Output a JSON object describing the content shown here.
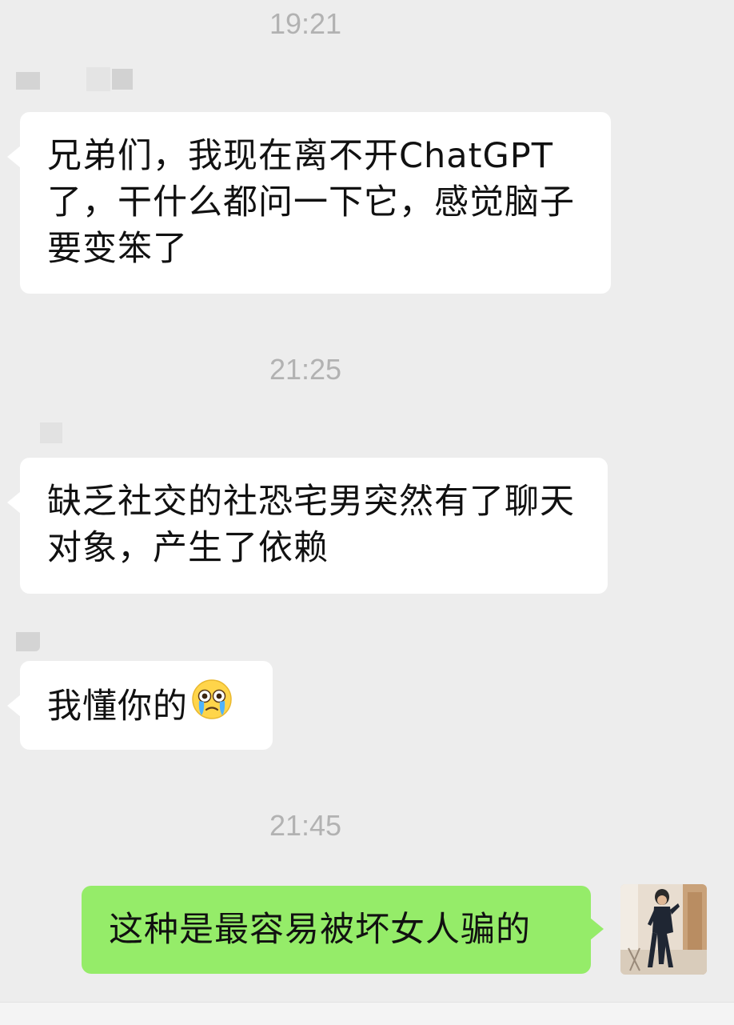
{
  "messages": [
    {
      "type": "time",
      "text": "19:21"
    },
    {
      "type": "incoming",
      "text": "兄弟们，我现在离不开ChatGPT了，干什么都问一下它，感觉脑子要变笨了"
    },
    {
      "type": "time",
      "text": "21:25"
    },
    {
      "type": "incoming",
      "text": "缺乏社交的社恐宅男突然有了聊天对象，产生了依赖"
    },
    {
      "type": "incoming",
      "text": "我懂你的",
      "emoji": "crying-face-emoji"
    },
    {
      "type": "time",
      "text": "21:45"
    },
    {
      "type": "outgoing",
      "text": "这种是最容易被坏女人骗的"
    }
  ],
  "icons": {
    "avatar": "user-avatar-photo",
    "emoji": "crying-face-emoji"
  },
  "colors": {
    "background": "#ededed",
    "incoming_bubble": "#ffffff",
    "outgoing_bubble": "#95ec69",
    "timestamp": "#b2b2b2",
    "text": "#111111"
  }
}
